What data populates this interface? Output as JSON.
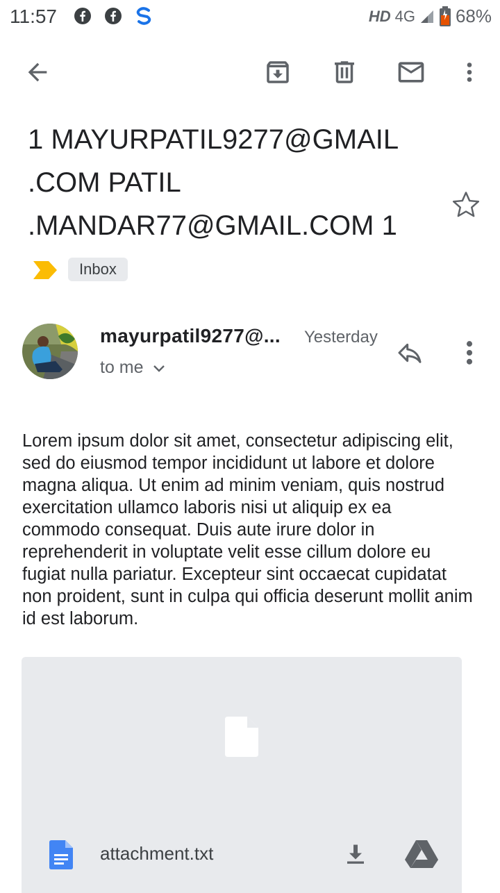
{
  "status_bar": {
    "time": "11:57",
    "network_hd": "HD",
    "network_type": "4G",
    "battery_percent": "68%",
    "icons": [
      "facebook-icon",
      "facebook-icon",
      "s-app-icon",
      "signal-icon",
      "battery-icon"
    ]
  },
  "toolbar": {
    "icons": [
      "back-arrow-icon",
      "archive-icon",
      "delete-icon",
      "mark-unread-icon",
      "more-vert-icon"
    ]
  },
  "email": {
    "subject": "1 MAYURPATIL9277@GMAIL\n.COM PATIL\n.MANDAR77@GMAIL.COM  1",
    "label": "Inbox",
    "sender": "mayurpatil9277@...",
    "date": "Yesterday",
    "recipient": "to me",
    "body": "Lorem ipsum dolor sit amet, consectetur adipiscing elit, sed do eiusmod tempor incididunt ut labore et dolore magna aliqua. Ut enim ad minim veniam, quis nostrud exercitation ullamco laboris nisi ut aliquip ex ea commodo consequat. Duis aute irure dolor in reprehenderit in voluptate velit esse cillum dolore eu fugiat nulla pariatur. Excepteur sint occaecat cupidatat non proident, sunt in culpa qui officia deserunt mollit anim id est laborum."
  },
  "attachment": {
    "filename": "attachment.txt"
  },
  "colors": {
    "important_marker": "#fbbc04",
    "doc_icon_blue": "#4285f4",
    "attachment_bg": "#e8eaed",
    "icon_grey": "#5f6368"
  }
}
